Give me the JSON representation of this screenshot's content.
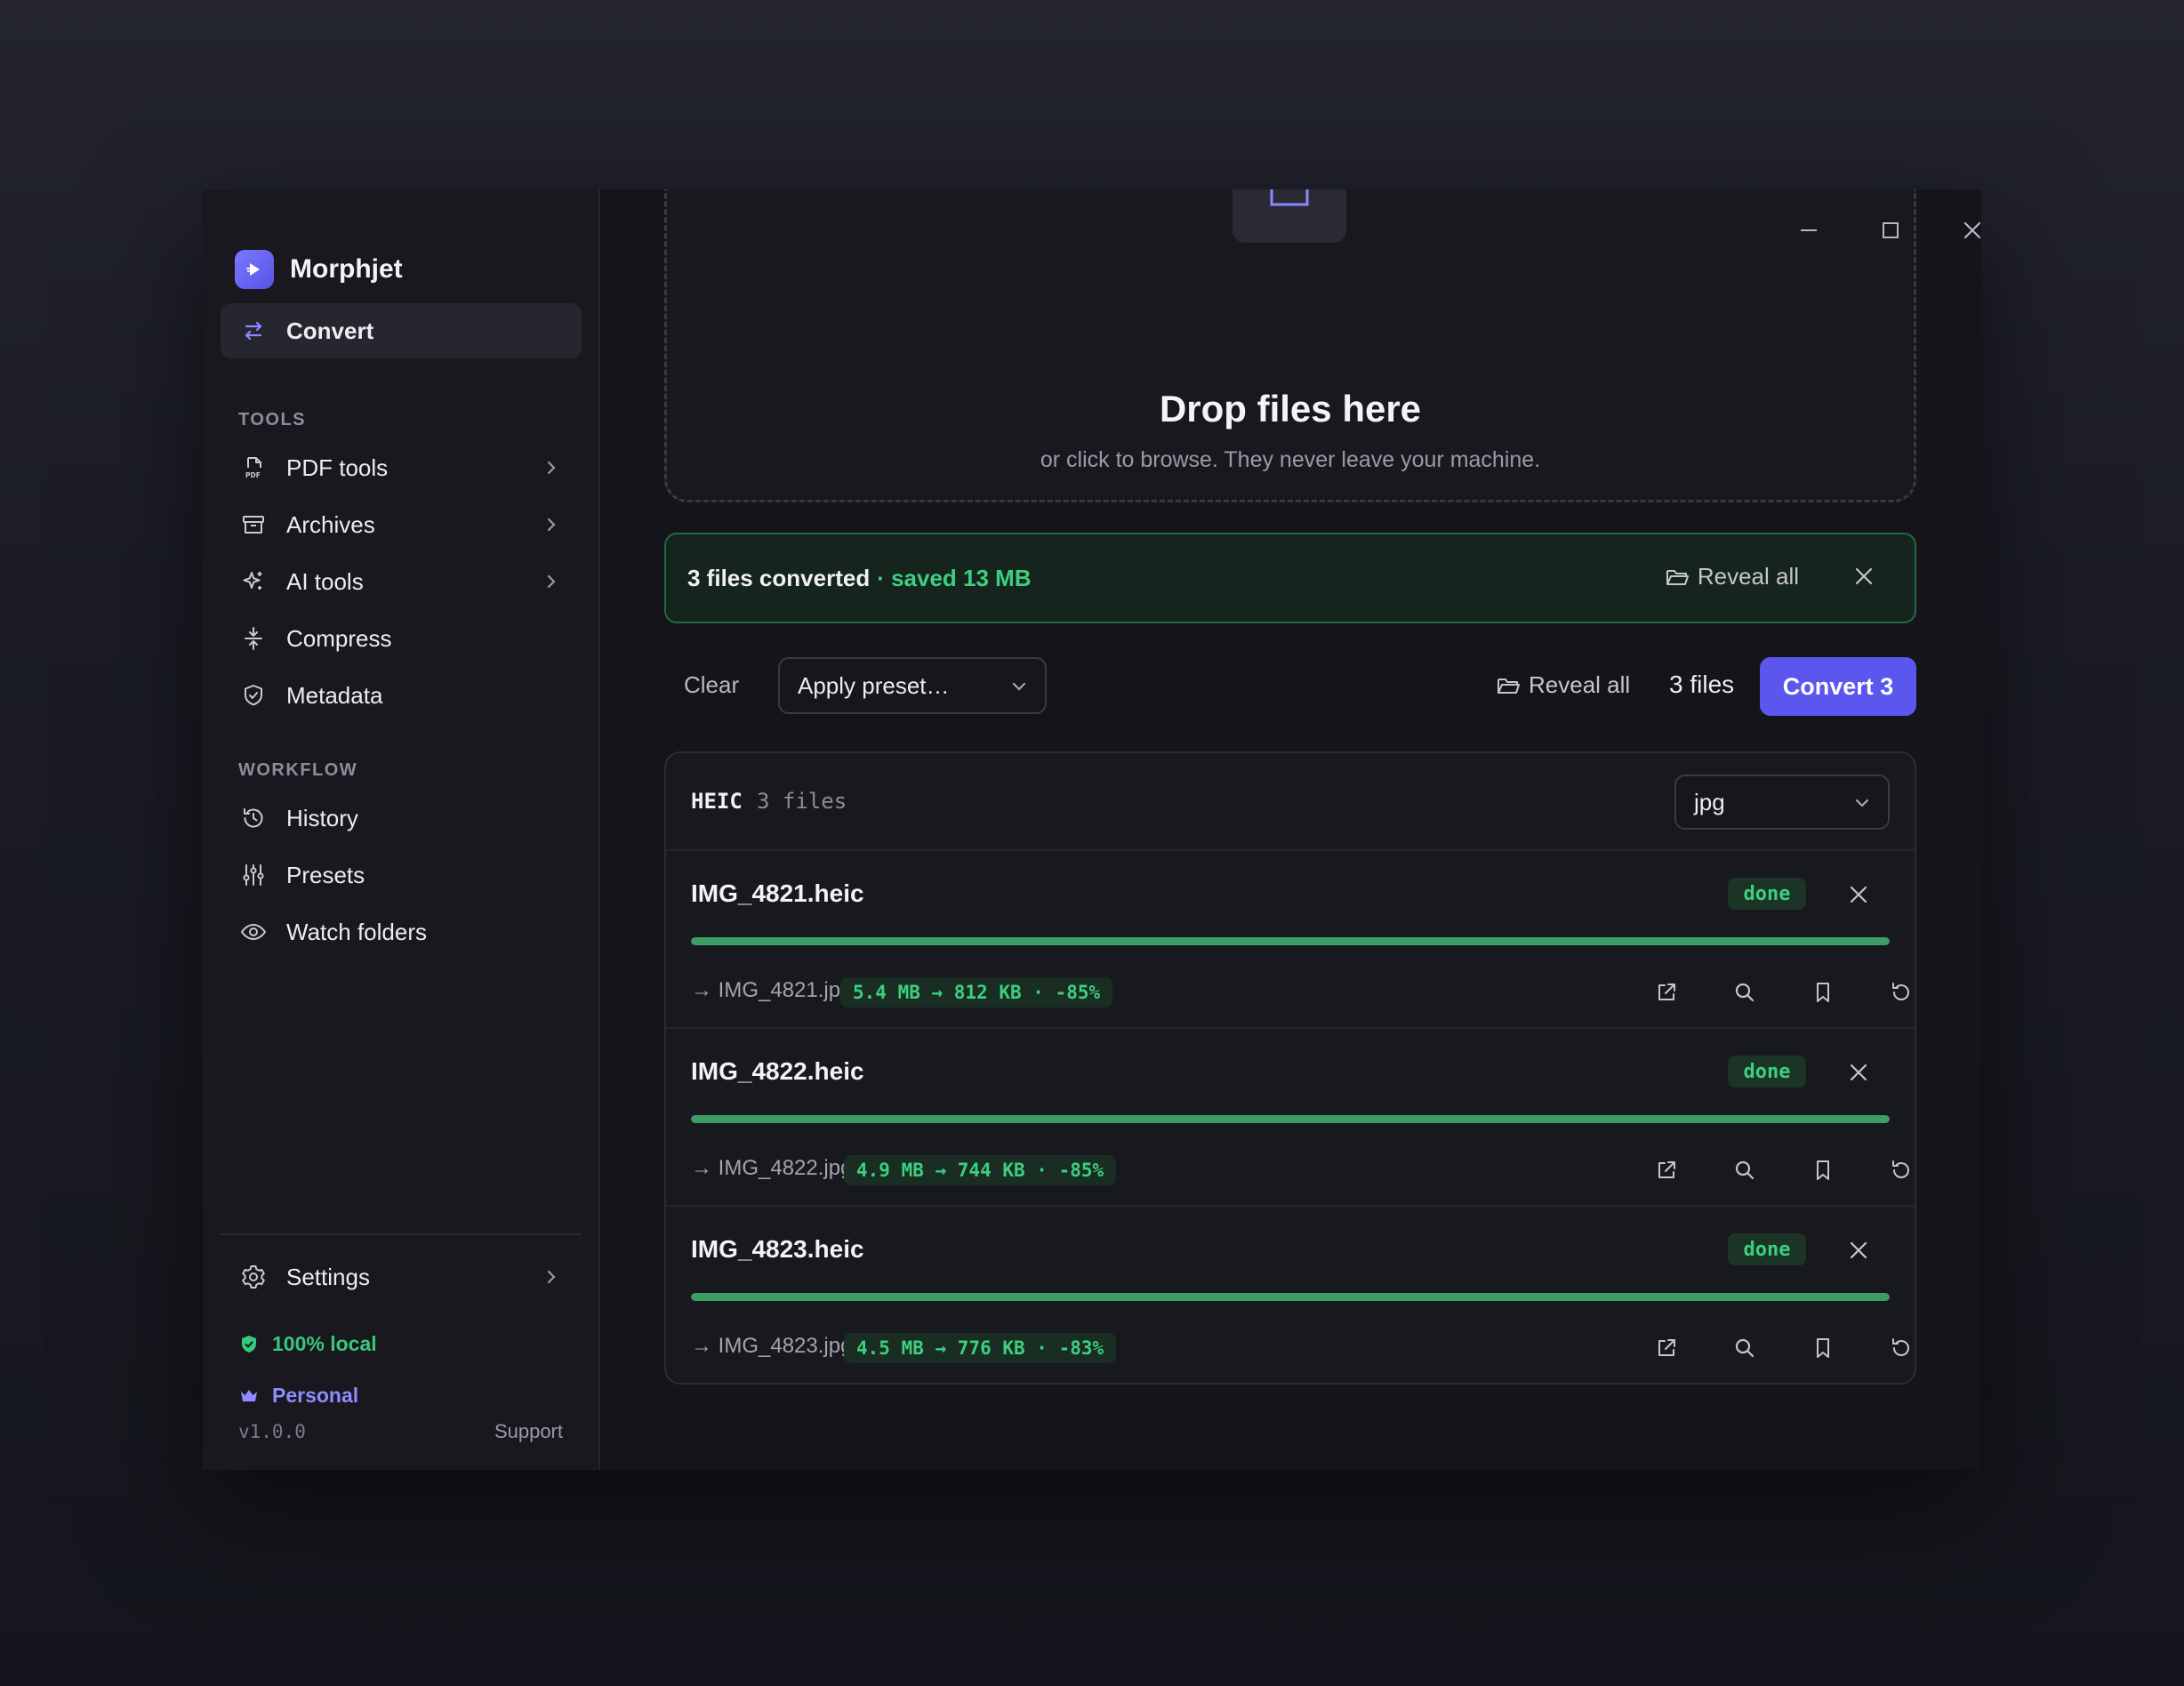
{
  "app": {
    "name": "Morphjet"
  },
  "window_controls": {
    "minimize": "minimize",
    "maximize": "maximize",
    "close": "close"
  },
  "sidebar": {
    "primary": {
      "label": "Convert",
      "icon": "swap-arrows-icon"
    },
    "tools_label": "TOOLS",
    "tools": [
      {
        "label": "PDF tools",
        "icon": "pdf-file-icon",
        "has_submenu": true
      },
      {
        "label": "Archives",
        "icon": "archive-box-icon",
        "has_submenu": true
      },
      {
        "label": "AI tools",
        "icon": "sparkle-icon",
        "has_submenu": true
      },
      {
        "label": "Compress",
        "icon": "compress-icon",
        "has_submenu": false
      },
      {
        "label": "Metadata",
        "icon": "shield-check-icon",
        "has_submenu": false
      }
    ],
    "workflow_label": "WORKFLOW",
    "workflow": [
      {
        "label": "History",
        "icon": "history-icon"
      },
      {
        "label": "Presets",
        "icon": "sliders-icon"
      },
      {
        "label": "Watch folders",
        "icon": "eye-icon"
      }
    ],
    "settings": {
      "label": "Settings",
      "icon": "gear-icon"
    },
    "local_status": "100% local",
    "plan": "Personal",
    "version": "v1.0.0",
    "support": "Support"
  },
  "dropzone": {
    "title": "Drop files here",
    "subtitle": "or click to browse. They never leave your machine."
  },
  "banner": {
    "text": "3 files converted",
    "saved": "· saved 13 MB",
    "reveal": "Reveal all"
  },
  "toolbar": {
    "clear": "Clear",
    "preset_placeholder": "Apply preset…",
    "reveal": "Reveal all",
    "count": "3 files",
    "convert": "Convert 3"
  },
  "group": {
    "type": "HEIC",
    "count": "3 files",
    "format": "jpg",
    "files": [
      {
        "name": "IMG_4821.heic",
        "status": "done",
        "progress": 1.0,
        "output": "→ IMG_4821.jpg",
        "size": "5.4 MB → 812 KB · -85%"
      },
      {
        "name": "IMG_4822.heic",
        "status": "done",
        "progress": 1.0,
        "output": "→ IMG_4822.jpg",
        "size": "4.9 MB → 744 KB · -85%"
      },
      {
        "name": "IMG_4823.heic",
        "status": "done",
        "progress": 1.0,
        "output": "→ IMG_4823.jpg",
        "size": "4.5 MB → 776 KB · -83%"
      }
    ]
  },
  "colors": {
    "accent": "#5b57ee",
    "success": "#3ccf80",
    "progress": "#3e9c66"
  }
}
